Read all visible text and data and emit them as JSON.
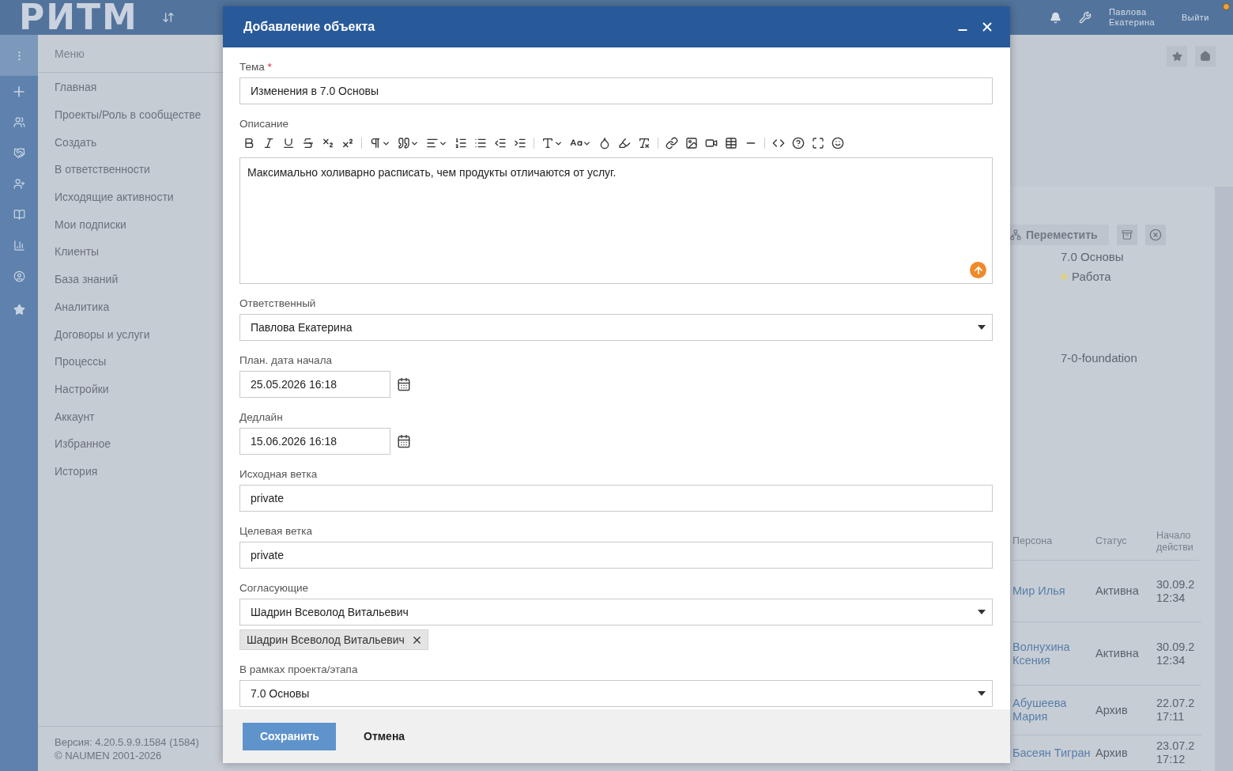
{
  "topbar": {
    "logo": "РИТМ",
    "user": "Павлова Екатерина",
    "logout": "Выйти"
  },
  "menu": {
    "title": "Меню",
    "items": [
      "Главная",
      "Проекты/Роль в сообществе",
      "Создать",
      "В ответственности",
      "Исходящие активности",
      "Мои подписки",
      "Клиенты",
      "База знаний",
      "Аналитика",
      "Договоры и услуги",
      "Процессы",
      "Настройки",
      "Аккаунт",
      "Избранное",
      "История"
    ],
    "version": "Версия: 4.20.5.9.9.1584 (1584)",
    "copyright": "© NAUMEN 2001-2026"
  },
  "page": {
    "move_action": "Переместить",
    "project": "7.0 Основы",
    "status": {
      "label": "Работа",
      "color": "#ddd08c"
    },
    "branch": "7-0-foundation",
    "table": {
      "columns": [
        "Персона",
        "Статус",
        "Начало действи"
      ],
      "rows": [
        {
          "person": "Мир Илья",
          "status": "Активна",
          "date": "30.09.2",
          "time": "12:34"
        },
        {
          "person": "Волнухина Ксения",
          "status": "Активна",
          "date": "30.09.2",
          "time": "12:34"
        },
        {
          "person": "Абушеева Мария",
          "status": "Архив",
          "date": "22.07.2",
          "time": "17:11"
        },
        {
          "person": "Басеян Тигран",
          "status": "Архив",
          "date": "23.07.2",
          "time": "17:12"
        }
      ]
    }
  },
  "dialog": {
    "title": "Добавление объекта",
    "fields": [
      {
        "kind": "text",
        "label": "Тема",
        "required_mark": "*",
        "value": "Изменения в 7.0 Основы"
      },
      {
        "kind": "editor",
        "label": "Описание",
        "value": "Максимально холиварно расписать, чем продукты отличаются от услуг."
      },
      {
        "kind": "select",
        "label": "Ответственный",
        "value": "Павлова Екатерина"
      },
      {
        "kind": "date",
        "label": "План. дата начала",
        "value": "25.05.2026 16:18"
      },
      {
        "kind": "date",
        "label": "Дедлайн",
        "value": "15.06.2026 16:18"
      },
      {
        "kind": "text",
        "label": "Исходная ветка",
        "value": "private"
      },
      {
        "kind": "text",
        "label": "Целевая ветка",
        "value": "private"
      },
      {
        "kind": "select",
        "label": "Согласующие",
        "value": "Шадрин Всеволод Витальевич",
        "tags": [
          "Шадрин Всеволод Витальевич"
        ]
      },
      {
        "kind": "select",
        "label": "В рамках проекта/этапа",
        "value": "7.0 Основы"
      }
    ],
    "buttons": [
      {
        "label": "Сохранить",
        "kind": "primary"
      },
      {
        "label": "Отмена",
        "kind": "link"
      }
    ]
  }
}
